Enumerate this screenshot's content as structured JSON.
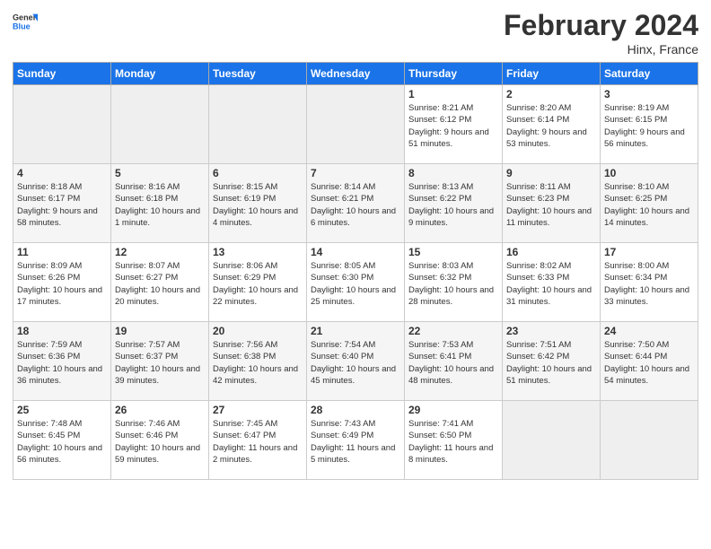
{
  "header": {
    "logo_general": "General",
    "logo_blue": "Blue",
    "month_year": "February 2024",
    "location": "Hinx, France"
  },
  "days_of_week": [
    "Sunday",
    "Monday",
    "Tuesday",
    "Wednesday",
    "Thursday",
    "Friday",
    "Saturday"
  ],
  "weeks": [
    [
      {
        "day": "",
        "info": ""
      },
      {
        "day": "",
        "info": ""
      },
      {
        "day": "",
        "info": ""
      },
      {
        "day": "",
        "info": ""
      },
      {
        "day": "1",
        "info": "Sunrise: 8:21 AM\nSunset: 6:12 PM\nDaylight: 9 hours and 51 minutes."
      },
      {
        "day": "2",
        "info": "Sunrise: 8:20 AM\nSunset: 6:14 PM\nDaylight: 9 hours and 53 minutes."
      },
      {
        "day": "3",
        "info": "Sunrise: 8:19 AM\nSunset: 6:15 PM\nDaylight: 9 hours and 56 minutes."
      }
    ],
    [
      {
        "day": "4",
        "info": "Sunrise: 8:18 AM\nSunset: 6:17 PM\nDaylight: 9 hours and 58 minutes."
      },
      {
        "day": "5",
        "info": "Sunrise: 8:16 AM\nSunset: 6:18 PM\nDaylight: 10 hours and 1 minute."
      },
      {
        "day": "6",
        "info": "Sunrise: 8:15 AM\nSunset: 6:19 PM\nDaylight: 10 hours and 4 minutes."
      },
      {
        "day": "7",
        "info": "Sunrise: 8:14 AM\nSunset: 6:21 PM\nDaylight: 10 hours and 6 minutes."
      },
      {
        "day": "8",
        "info": "Sunrise: 8:13 AM\nSunset: 6:22 PM\nDaylight: 10 hours and 9 minutes."
      },
      {
        "day": "9",
        "info": "Sunrise: 8:11 AM\nSunset: 6:23 PM\nDaylight: 10 hours and 11 minutes."
      },
      {
        "day": "10",
        "info": "Sunrise: 8:10 AM\nSunset: 6:25 PM\nDaylight: 10 hours and 14 minutes."
      }
    ],
    [
      {
        "day": "11",
        "info": "Sunrise: 8:09 AM\nSunset: 6:26 PM\nDaylight: 10 hours and 17 minutes."
      },
      {
        "day": "12",
        "info": "Sunrise: 8:07 AM\nSunset: 6:27 PM\nDaylight: 10 hours and 20 minutes."
      },
      {
        "day": "13",
        "info": "Sunrise: 8:06 AM\nSunset: 6:29 PM\nDaylight: 10 hours and 22 minutes."
      },
      {
        "day": "14",
        "info": "Sunrise: 8:05 AM\nSunset: 6:30 PM\nDaylight: 10 hours and 25 minutes."
      },
      {
        "day": "15",
        "info": "Sunrise: 8:03 AM\nSunset: 6:32 PM\nDaylight: 10 hours and 28 minutes."
      },
      {
        "day": "16",
        "info": "Sunrise: 8:02 AM\nSunset: 6:33 PM\nDaylight: 10 hours and 31 minutes."
      },
      {
        "day": "17",
        "info": "Sunrise: 8:00 AM\nSunset: 6:34 PM\nDaylight: 10 hours and 33 minutes."
      }
    ],
    [
      {
        "day": "18",
        "info": "Sunrise: 7:59 AM\nSunset: 6:36 PM\nDaylight: 10 hours and 36 minutes."
      },
      {
        "day": "19",
        "info": "Sunrise: 7:57 AM\nSunset: 6:37 PM\nDaylight: 10 hours and 39 minutes."
      },
      {
        "day": "20",
        "info": "Sunrise: 7:56 AM\nSunset: 6:38 PM\nDaylight: 10 hours and 42 minutes."
      },
      {
        "day": "21",
        "info": "Sunrise: 7:54 AM\nSunset: 6:40 PM\nDaylight: 10 hours and 45 minutes."
      },
      {
        "day": "22",
        "info": "Sunrise: 7:53 AM\nSunset: 6:41 PM\nDaylight: 10 hours and 48 minutes."
      },
      {
        "day": "23",
        "info": "Sunrise: 7:51 AM\nSunset: 6:42 PM\nDaylight: 10 hours and 51 minutes."
      },
      {
        "day": "24",
        "info": "Sunrise: 7:50 AM\nSunset: 6:44 PM\nDaylight: 10 hours and 54 minutes."
      }
    ],
    [
      {
        "day": "25",
        "info": "Sunrise: 7:48 AM\nSunset: 6:45 PM\nDaylight: 10 hours and 56 minutes."
      },
      {
        "day": "26",
        "info": "Sunrise: 7:46 AM\nSunset: 6:46 PM\nDaylight: 10 hours and 59 minutes."
      },
      {
        "day": "27",
        "info": "Sunrise: 7:45 AM\nSunset: 6:47 PM\nDaylight: 11 hours and 2 minutes."
      },
      {
        "day": "28",
        "info": "Sunrise: 7:43 AM\nSunset: 6:49 PM\nDaylight: 11 hours and 5 minutes."
      },
      {
        "day": "29",
        "info": "Sunrise: 7:41 AM\nSunset: 6:50 PM\nDaylight: 11 hours and 8 minutes."
      },
      {
        "day": "",
        "info": ""
      },
      {
        "day": "",
        "info": ""
      }
    ]
  ]
}
